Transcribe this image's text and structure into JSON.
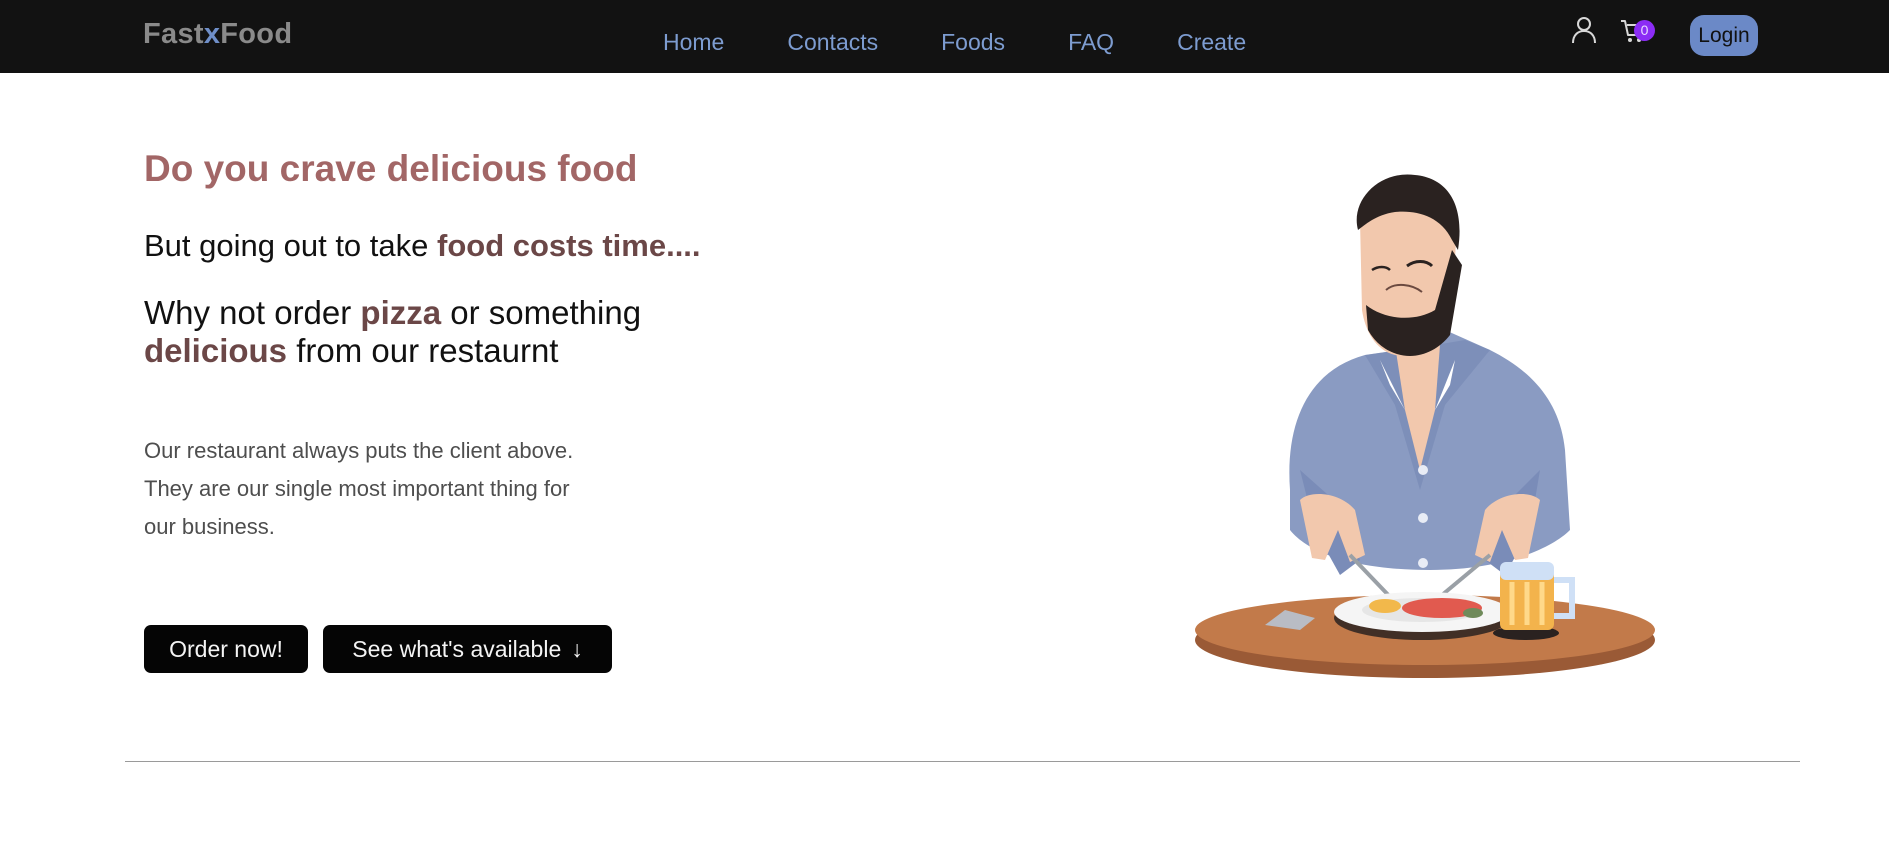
{
  "brand": {
    "left": "Fast",
    "mid": "x",
    "right": "Food"
  },
  "nav": [
    "Home",
    "Contacts",
    "Foods",
    "FAQ",
    "Create"
  ],
  "header": {
    "cart_count": "0",
    "login_label": "Login",
    "user_icon": "user-icon",
    "cart_icon": "cart-icon"
  },
  "hero": {
    "headline": "Do you crave delicious food",
    "line2_plain": "But going out to take ",
    "line2_bold": "food costs time....",
    "line3_a": "Why not order ",
    "line3_bold1": "pizza",
    "line3_b": " or something ",
    "line3_bold2": "delicious",
    "line3_c": " from our restaurnt",
    "description": "Our restaurant always puts the client above. They are our single most important thing for our business.",
    "order_button": "Order now!",
    "see_button": "See what's available",
    "see_arrow": "↓"
  },
  "colors": {
    "nav_bg": "#121212",
    "nav_link": "#7d9cd0",
    "headline": "#a26666",
    "accent": "#6b4747",
    "badge": "#8b2cf5",
    "login_bg": "#6b89c7"
  }
}
